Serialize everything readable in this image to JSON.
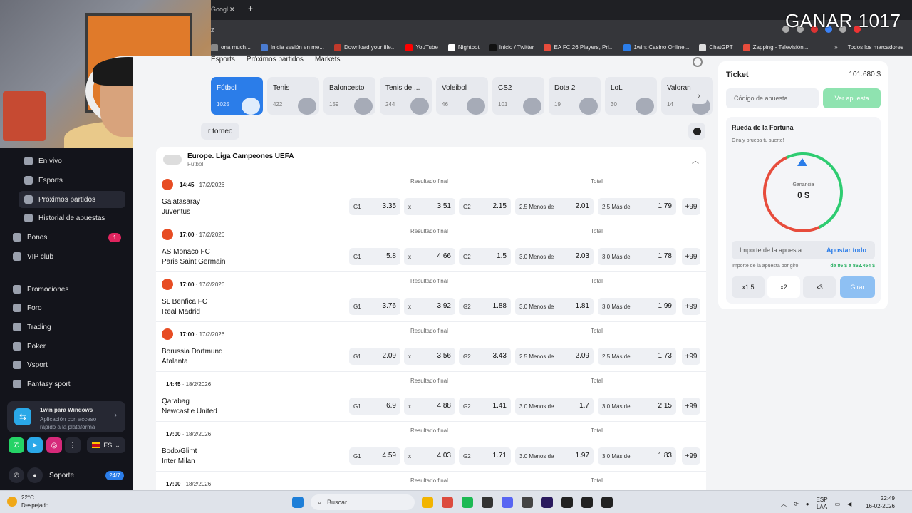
{
  "overlay_title": "GANAR 1017",
  "browser": {
    "tab_fragment": "Googl",
    "address_fragment": "z",
    "bookmarks": [
      {
        "label": "ona much...",
        "color": "#888"
      },
      {
        "label": "Inicia sesión en me...",
        "color": "#4a7bd0"
      },
      {
        "label": "Download your file...",
        "color": "#c0392b"
      },
      {
        "label": "YouTube",
        "color": "#ff0000"
      },
      {
        "label": "Nightbot",
        "color": "#ffffff"
      },
      {
        "label": "Inicio / Twitter",
        "color": "#111111"
      },
      {
        "label": "EA FC 26 Players, Pri...",
        "color": "#e74c3c"
      },
      {
        "label": "1win: Casino Online...",
        "color": "#2b7de9"
      },
      {
        "label": "ChatGPT",
        "color": "#dddddd"
      },
      {
        "label": "Zapping - Televisión...",
        "color": "#e74c3c"
      }
    ],
    "bookmarks_more": "»",
    "all_bookmarks": "Todos los marcadores"
  },
  "sidebar": {
    "sub_items": [
      "En vivo",
      "Esports",
      "Próximos partidos",
      "Historial de apuestas"
    ],
    "items": [
      "Bonos",
      "VIP club",
      "Promociones",
      "Foro",
      "Trading",
      "Poker",
      "Vsport",
      "Fantasy sport"
    ],
    "bonos_badge": "1",
    "app_title": "1win para Windows",
    "app_desc": "Aplicación con acceso rápido a la plataforma",
    "lang": "ES",
    "support": "Soporte",
    "support_badge": "24/7"
  },
  "topnav": [
    "Esports",
    "Próximos partidos",
    "Markets"
  ],
  "sports": [
    {
      "name": "Fútbol",
      "count": "1025"
    },
    {
      "name": "Tenis",
      "count": "422"
    },
    {
      "name": "Baloncesto",
      "count": "159"
    },
    {
      "name": "Tenis de ...",
      "count": "244"
    },
    {
      "name": "Voleibol",
      "count": "46"
    },
    {
      "name": "CS2",
      "count": "101"
    },
    {
      "name": "Dota 2",
      "count": "19"
    },
    {
      "name": "LoL",
      "count": "30"
    },
    {
      "name": "Valoran",
      "count": "14"
    }
  ],
  "torneo_label": "r torneo",
  "league": {
    "name": "Europe. Liga Campeones UEFA",
    "sport": "Fútbol"
  },
  "labels": {
    "resultado": "Resultado final",
    "total": "Total",
    "g1": "G1",
    "x": "x",
    "g2": "G2",
    "more": "+99"
  },
  "matches": [
    {
      "time": "14:45",
      "date": "17/2/2026",
      "home": "Galatasaray",
      "away": "Juventus",
      "g1": "3.35",
      "x": "3.51",
      "g2": "2.15",
      "under_lbl": "2.5 Menos de",
      "under": "2.01",
      "over_lbl": "2.5 Más de",
      "over": "1.79",
      "hot": true
    },
    {
      "time": "17:00",
      "date": "17/2/2026",
      "home": "AS Monaco FC",
      "away": "Paris Saint Germain",
      "g1": "5.8",
      "x": "4.66",
      "g2": "1.5",
      "under_lbl": "3.0 Menos de",
      "under": "2.03",
      "over_lbl": "3.0 Más de",
      "over": "1.78",
      "hot": true
    },
    {
      "time": "17:00",
      "date": "17/2/2026",
      "home": "SL Benfica FC",
      "away": "Real Madrid",
      "g1": "3.76",
      "x": "3.92",
      "g2": "1.88",
      "under_lbl": "3.0 Menos de",
      "under": "1.81",
      "over_lbl": "3.0 Más de",
      "over": "1.99",
      "hot": true
    },
    {
      "time": "17:00",
      "date": "17/2/2026",
      "home": "Borussia Dortmund",
      "away": "Atalanta",
      "g1": "2.09",
      "x": "3.56",
      "g2": "3.43",
      "under_lbl": "2.5 Menos de",
      "under": "2.09",
      "over_lbl": "2.5 Más de",
      "over": "1.73",
      "hot": true
    },
    {
      "time": "14:45",
      "date": "18/2/2026",
      "home": "Qarabag",
      "away": "Newcastle United",
      "g1": "6.9",
      "x": "4.88",
      "g2": "1.41",
      "under_lbl": "3.0 Menos de",
      "under": "1.7",
      "over_lbl": "3.0 Más de",
      "over": "2.15",
      "hot": false
    },
    {
      "time": "17:00",
      "date": "18/2/2026",
      "home": "Bodo/Glimt",
      "away": "Inter Milan",
      "g1": "4.59",
      "x": "4.03",
      "g2": "1.71",
      "under_lbl": "3.0 Menos de",
      "under": "1.97",
      "over_lbl": "3.0 Más de",
      "over": "1.83",
      "hot": false
    },
    {
      "time": "17:00",
      "date": "18/2/2026",
      "home": "",
      "away": "",
      "g1": "",
      "x": "",
      "g2": "",
      "under_lbl": "",
      "under": "",
      "over_lbl": "",
      "over": "",
      "hot": false
    }
  ],
  "ticket": {
    "title": "Ticket",
    "balance": "101.680 $",
    "code_placeholder": "Código de apuesta",
    "ver": "Ver apuesta",
    "wheel_title": "Rueda de la Fortuna",
    "wheel_sub": "Gira y prueba tu suerte!",
    "gain_label": "Ganancia",
    "gain_value": "0 $",
    "stake_label": "Importe de la apuesta",
    "all_in": "Apostar todo",
    "range_label": "Importe de la apuesta por giro",
    "range_value": "de 86 $ a 862.454 $",
    "mult": [
      "x1.5",
      "x2",
      "x3"
    ],
    "girar": "Girar"
  },
  "taskbar": {
    "temp": "22°C",
    "weather": "Despejado",
    "search": "Buscar",
    "lang1": "ESP",
    "lang2": "LAA",
    "time": "22:49",
    "date": "16-02-2026"
  }
}
